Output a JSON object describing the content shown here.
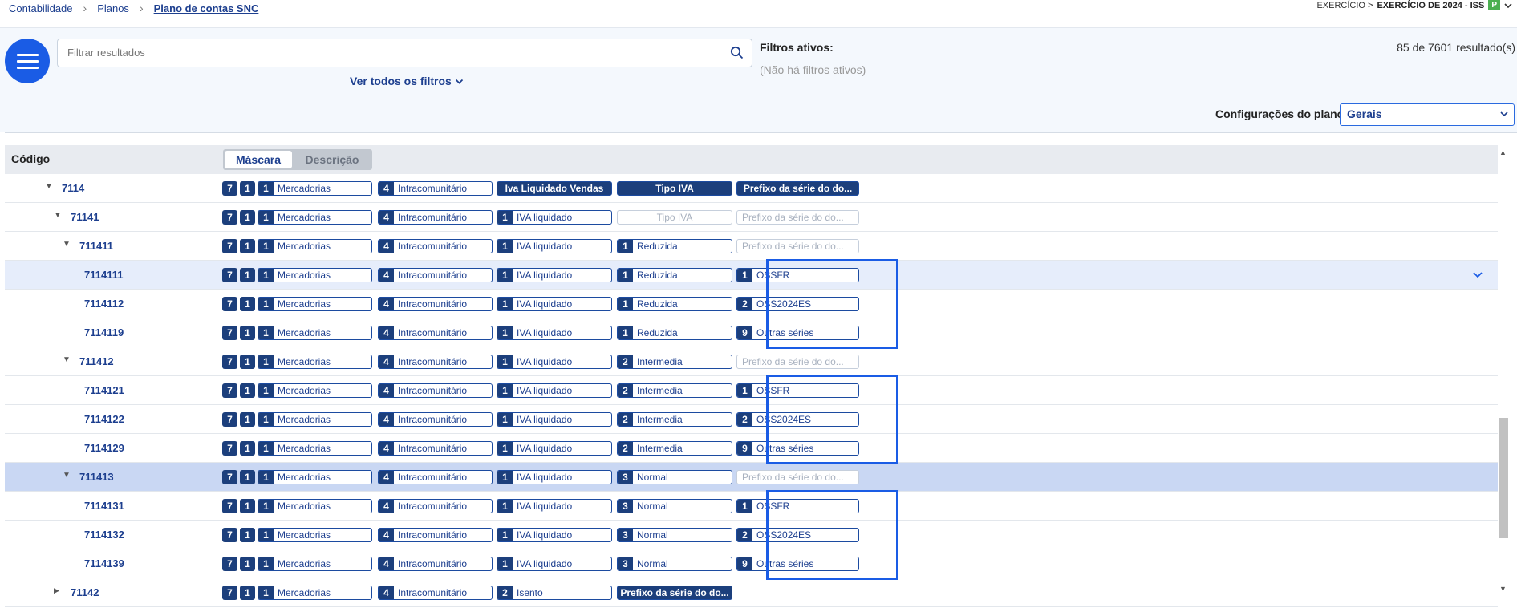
{
  "breadcrumb": {
    "items": [
      "Contabilidade",
      "Planos",
      "Plano de contas SNC"
    ]
  },
  "exercise": {
    "prefix": "EXERCÍCIO >",
    "name": "EXERCÍCIO DE 2024 - ISS",
    "badge": "P"
  },
  "search": {
    "placeholder": "Filtrar resultados"
  },
  "filters": {
    "see_all": "Ver todos os filtros",
    "active_label": "Filtros ativos:",
    "none": "(Não há filtros ativos)",
    "results": "85 de 7601 resultado(s)"
  },
  "config": {
    "label": "Configurações do plano:",
    "value": "Gerais"
  },
  "table": {
    "code_header": "Código",
    "mask_label": "Máscara",
    "desc_label": "Descrição",
    "rows": [
      {
        "code": "7114",
        "c5": {
          "type": "filled",
          "text": "Iva Liquidado Vendas"
        },
        "c6": {
          "type": "filled",
          "text": "Tipo IVA"
        },
        "c7": {
          "type": "filled",
          "text": "Prefixo da série do do..."
        }
      },
      {
        "code": "71141",
        "c5": {
          "n": "1",
          "text": "IVA liquidado"
        },
        "c6": {
          "type": "empty",
          "text": "Tipo IVA"
        },
        "c7": {
          "type": "empty",
          "text": "Prefixo da série do do..."
        }
      },
      {
        "code": "711411",
        "c5": {
          "n": "1",
          "text": "IVA liquidado"
        },
        "c6": {
          "n": "1",
          "text": "Reduzida"
        },
        "c7": {
          "type": "empty",
          "text": "Prefixo da série do do..."
        }
      },
      {
        "code": "7114111",
        "c5": {
          "n": "1",
          "text": "IVA liquidado"
        },
        "c6": {
          "n": "1",
          "text": "Reduzida"
        },
        "c7": {
          "n": "1",
          "text": "OSSFR"
        }
      },
      {
        "code": "7114112",
        "c5": {
          "n": "1",
          "text": "IVA liquidado"
        },
        "c6": {
          "n": "1",
          "text": "Reduzida"
        },
        "c7": {
          "n": "2",
          "text": "OSS2024ES"
        }
      },
      {
        "code": "7114119",
        "c5": {
          "n": "1",
          "text": "IVA liquidado"
        },
        "c6": {
          "n": "1",
          "text": "Reduzida"
        },
        "c7": {
          "n": "9",
          "text": "Outras séries"
        }
      },
      {
        "code": "711412",
        "c5": {
          "n": "1",
          "text": "IVA liquidado"
        },
        "c6": {
          "n": "2",
          "text": "Intermedia"
        },
        "c7": {
          "type": "empty",
          "text": "Prefixo da série do do..."
        }
      },
      {
        "code": "7114121",
        "c5": {
          "n": "1",
          "text": "IVA liquidado"
        },
        "c6": {
          "n": "2",
          "text": "Intermedia"
        },
        "c7": {
          "n": "1",
          "text": "OSSFR"
        }
      },
      {
        "code": "7114122",
        "c5": {
          "n": "1",
          "text": "IVA liquidado"
        },
        "c6": {
          "n": "2",
          "text": "Intermedia"
        },
        "c7": {
          "n": "2",
          "text": "OSS2024ES"
        }
      },
      {
        "code": "7114129",
        "c5": {
          "n": "1",
          "text": "IVA liquidado"
        },
        "c6": {
          "n": "2",
          "text": "Intermedia"
        },
        "c7": {
          "n": "9",
          "text": "Outras séries"
        }
      },
      {
        "code": "711413",
        "c5": {
          "n": "1",
          "text": "IVA liquidado"
        },
        "c6": {
          "n": "3",
          "text": "Normal"
        },
        "c7": {
          "type": "empty",
          "text": "Prefixo da série do do..."
        }
      },
      {
        "code": "7114131",
        "c5": {
          "n": "1",
          "text": "IVA liquidado"
        },
        "c6": {
          "n": "3",
          "text": "Normal"
        },
        "c7": {
          "n": "1",
          "text": "OSSFR"
        }
      },
      {
        "code": "7114132",
        "c5": {
          "n": "1",
          "text": "IVA liquidado"
        },
        "c6": {
          "n": "3",
          "text": "Normal"
        },
        "c7": {
          "n": "2",
          "text": "OSS2024ES"
        }
      },
      {
        "code": "7114139",
        "c5": {
          "n": "1",
          "text": "IVA liquidado"
        },
        "c6": {
          "n": "3",
          "text": "Normal"
        },
        "c7": {
          "n": "9",
          "text": "Outras séries"
        }
      },
      {
        "code": "71142",
        "c5": {
          "n": "2",
          "text": "Isento"
        },
        "c6": {
          "type": "filled",
          "text": "Prefixo da série do do..."
        },
        "c7": null
      }
    ],
    "common": {
      "d1": "7",
      "d2": "1",
      "c3": {
        "n": "1",
        "text": "Mercadorias"
      },
      "c4": {
        "n": "4",
        "text": "Intracomunitário"
      }
    }
  },
  "colors": {
    "accent": "#1a5ce5",
    "dark_navy": "#1c3f7c",
    "link": "#1d3f8f"
  }
}
